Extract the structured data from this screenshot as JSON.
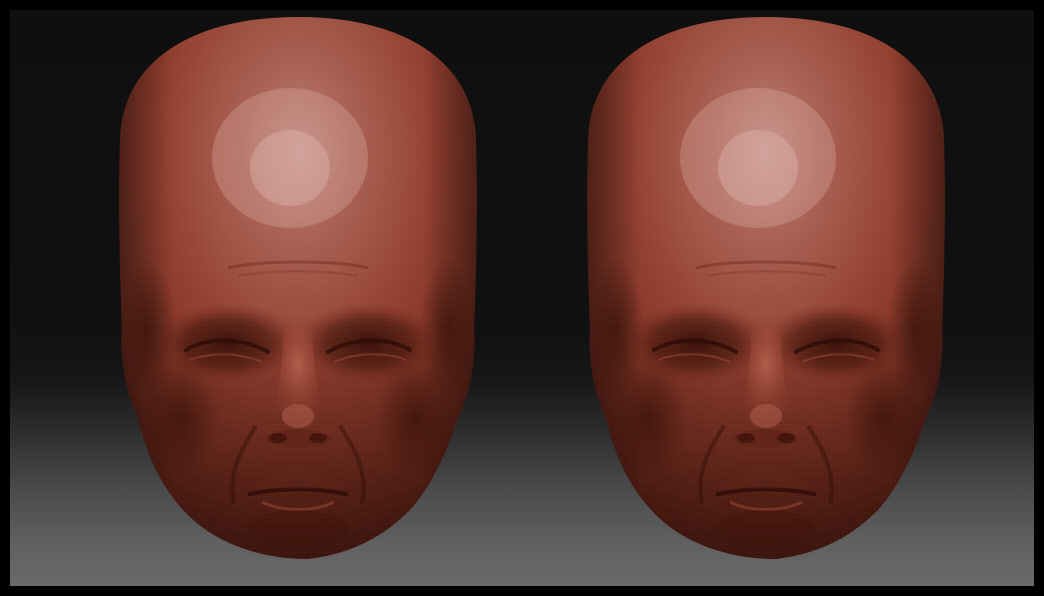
{
  "scene": {
    "kind": "sculpt-viewport",
    "layout": "two-identical-head-renders-side-by-side",
    "heads": [
      {
        "id": "left",
        "material": "red-clay"
      },
      {
        "id": "right",
        "material": "red-clay"
      }
    ]
  },
  "colors": {
    "border": "#000000",
    "background_top": "#0f0f0f",
    "background_bottom": "#6a6a6a",
    "clay_highlight": "#c98a82",
    "clay_base": "#9a3f2f",
    "clay_shadow": "#3a1209"
  }
}
